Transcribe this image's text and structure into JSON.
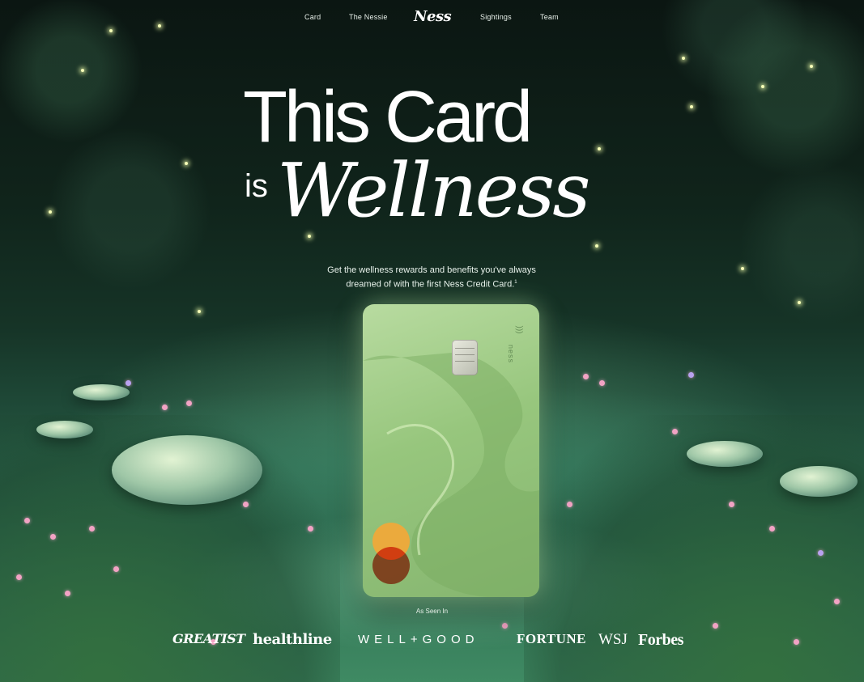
{
  "nav": {
    "links_left": [
      "Card",
      "The Nessie"
    ],
    "brand": "Ness",
    "links_right": [
      "Sightings",
      "Team"
    ]
  },
  "hero": {
    "line1": "This Card",
    "line2_prefix": "is",
    "line2_script": "Wellness",
    "subtitle_line1": "Get the wellness rewards and benefits you've always",
    "subtitle_line2": "dreamed of with the first Ness Credit Card.",
    "subtitle_footnote": "1"
  },
  "card": {
    "name": "ness",
    "contactless_icon": "contactless-icon",
    "network": "mastercard"
  },
  "press": {
    "label": "As Seen In",
    "logos": [
      "GREATIST",
      "healthline",
      "WELL+GOOD",
      "FORTUNE",
      "WSJ",
      "Forbes"
    ]
  },
  "colors": {
    "card_green": "#97c67d",
    "mc_yellow": "#f0a93a",
    "mc_red": "#e04a2f"
  }
}
